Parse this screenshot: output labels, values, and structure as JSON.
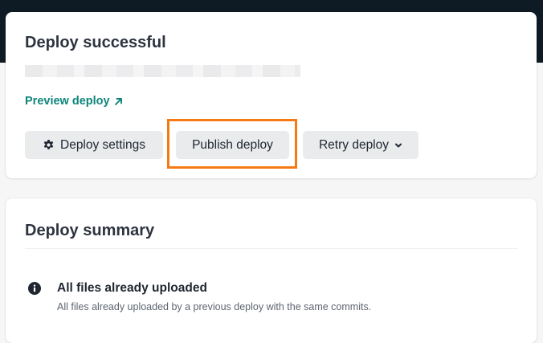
{
  "deploy_card": {
    "title": "Deploy successful",
    "preview_link": "Preview deploy",
    "buttons": {
      "settings": "Deploy settings",
      "publish": "Publish deploy",
      "retry": "Retry deploy"
    }
  },
  "summary_card": {
    "title": "Deploy summary",
    "items": [
      {
        "heading": "All files already uploaded",
        "description": "All files already uploaded by a previous deploy with the same commits."
      }
    ]
  },
  "colors": {
    "topbar": "#0f1b24",
    "link": "#0d8579",
    "highlight": "#f57a13",
    "button_bg": "#e9ebed"
  },
  "icons": [
    "arrow-up-right-icon",
    "gear-icon",
    "chevron-down-icon",
    "info-icon"
  ]
}
